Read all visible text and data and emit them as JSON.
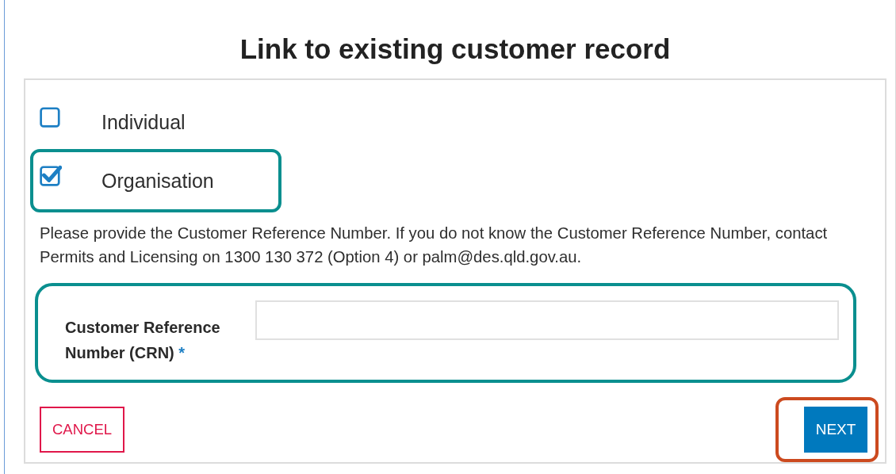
{
  "title": "Link to existing customer record",
  "options": [
    {
      "label": "Individual",
      "checked": false
    },
    {
      "label": "Organisation",
      "checked": true,
      "color": "#0a8f8f"
    }
  ],
  "instructions": "Please provide the Customer Reference Number. If you do not know the Customer Reference Number, contact Permits and Licensing on 1300 130 372 (Option 4) or palm@des.qld.gov.au.",
  "crn_field": {
    "label": "Customer Reference Number (CRN)",
    "required_mark": "*",
    "color": "#0a8f8f"
  },
  "buttons": [
    {
      "label": "CANCEL",
      "kind": "secondary"
    },
    {
      "label": "NEXT",
      "kind": "primary",
      "color": "#cc4a1f"
    }
  ]
}
